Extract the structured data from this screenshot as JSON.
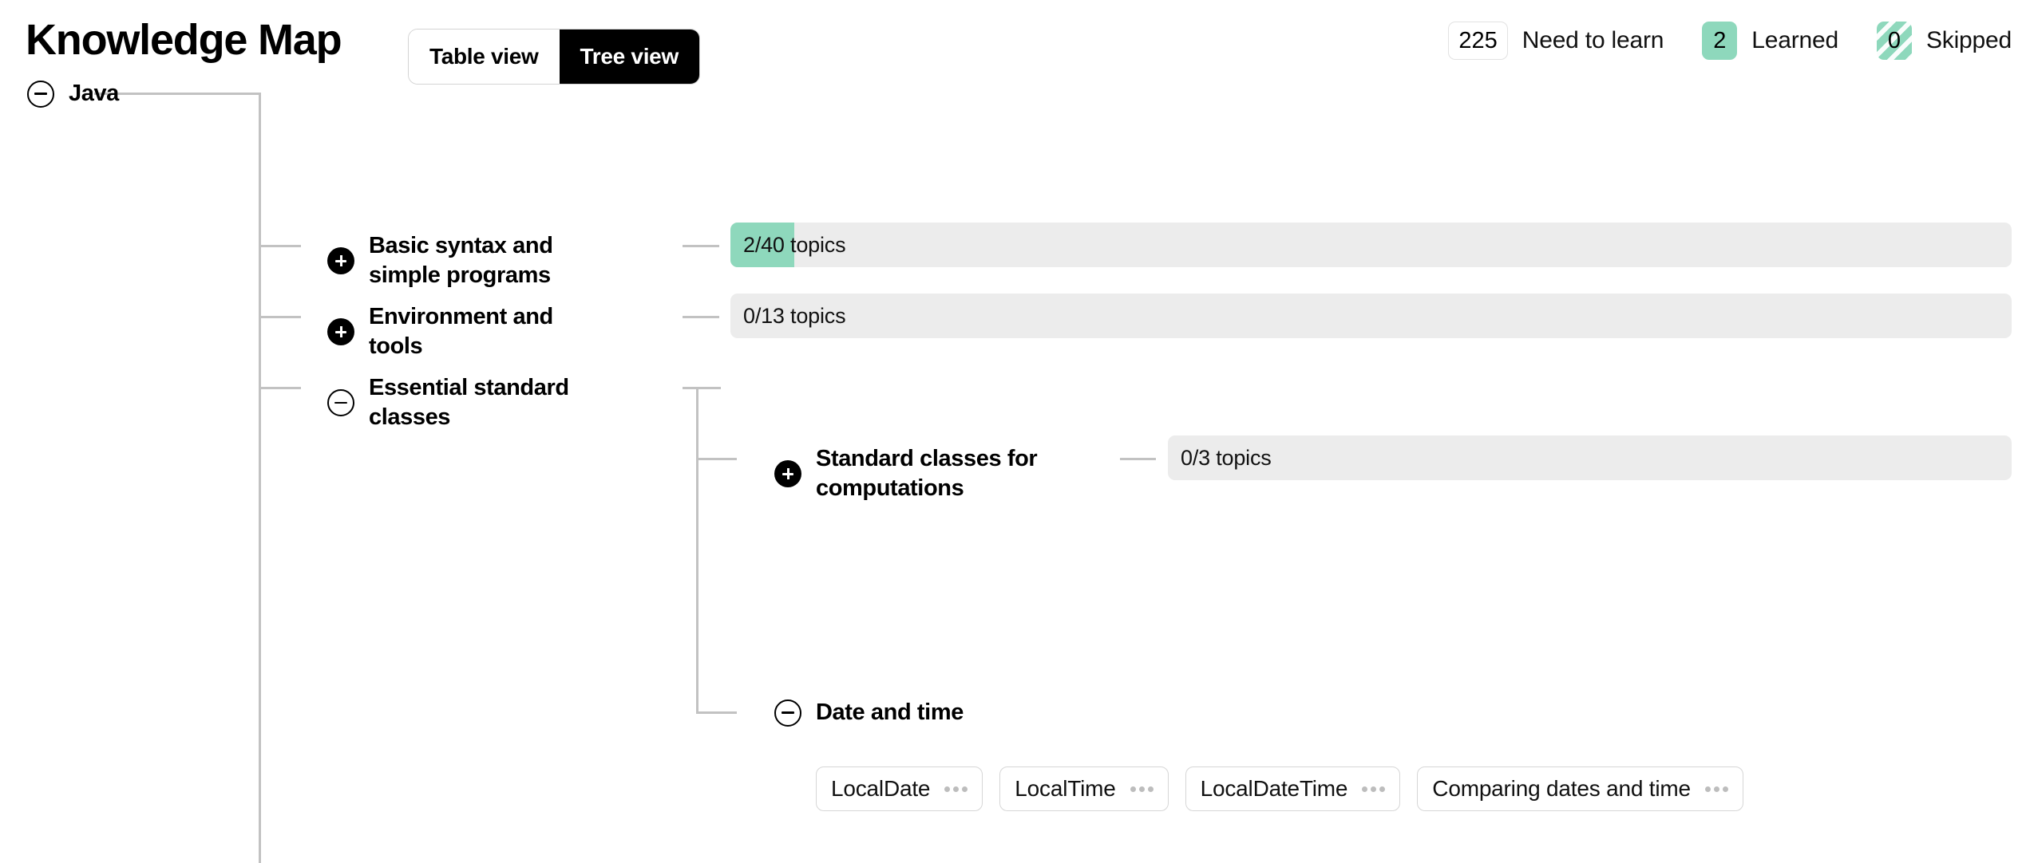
{
  "header": {
    "title": "Knowledge Map",
    "view_toggle": {
      "options": [
        {
          "label": "Table view",
          "active": false
        },
        {
          "label": "Tree view",
          "active": true
        }
      ]
    },
    "stats": [
      {
        "count": "225",
        "label": "Need to learn",
        "style": "plain"
      },
      {
        "count": "2",
        "label": "Learned",
        "style": "learned"
      },
      {
        "count": "0",
        "label": "Skipped",
        "style": "skipped"
      }
    ]
  },
  "colors": {
    "accent_green": "#8ed8bc",
    "track_gray": "#ececec",
    "line_gray": "#c2c2c2",
    "chip_border": "#d6d6d6",
    "black": "#000000"
  },
  "tree": {
    "root": {
      "label": "Java",
      "expanded": true,
      "toggle_icon": "minus-circle-icon"
    },
    "level2": [
      {
        "label": "Basic syntax and simple programs",
        "expanded": false,
        "toggle_icon": "plus-circle-icon",
        "progress": {
          "text": "2/40 topics",
          "learned": 2,
          "total": 40,
          "percent": 5
        }
      },
      {
        "label": "Environment and tools",
        "expanded": false,
        "toggle_icon": "plus-circle-icon",
        "progress": {
          "text": "0/13 topics",
          "learned": 0,
          "total": 13,
          "percent": 0
        }
      },
      {
        "label": "Essential standard classes",
        "expanded": true,
        "toggle_icon": "minus-circle-icon",
        "progress": null
      }
    ],
    "level3": [
      {
        "label": "Standard classes for computations",
        "expanded": false,
        "toggle_icon": "plus-circle-icon",
        "progress": {
          "text": "0/3 topics",
          "learned": 0,
          "total": 3,
          "percent": 0
        }
      },
      {
        "label": "Date and time",
        "expanded": true,
        "toggle_icon": "minus-circle-icon",
        "progress": null
      }
    ],
    "topics": [
      {
        "label": "LocalDate",
        "menu_icon": "ellipsis-icon"
      },
      {
        "label": "LocalTime",
        "menu_icon": "ellipsis-icon"
      },
      {
        "label": "LocalDateTime",
        "menu_icon": "ellipsis-icon"
      },
      {
        "label": "Comparing dates and time",
        "menu_icon": "ellipsis-icon"
      }
    ]
  }
}
